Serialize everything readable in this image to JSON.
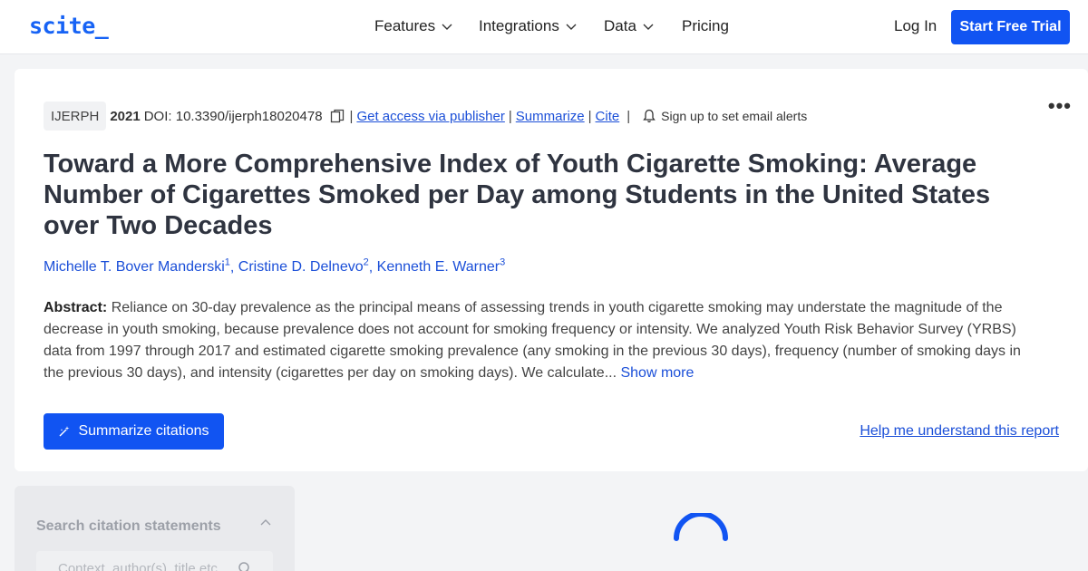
{
  "nav": {
    "logo": "scite_",
    "items": [
      {
        "label": "Features",
        "has_dropdown": true
      },
      {
        "label": "Integrations",
        "has_dropdown": true
      },
      {
        "label": "Data",
        "has_dropdown": true
      },
      {
        "label": "Pricing",
        "has_dropdown": false
      }
    ],
    "login": "Log In",
    "cta": "Start Free Trial"
  },
  "paper": {
    "journal": "IJERPH",
    "year": "2021",
    "doi": "DOI: 10.3390/ijerph18020478",
    "links": {
      "access": "Get access via publisher",
      "summarize": "Summarize",
      "cite": "Cite"
    },
    "alerts": "Sign up to set email alerts",
    "more_icon": "more-horizontal-icon",
    "title": "Toward a More Comprehensive Index of Youth Cigarette Smoking: Average Number of Cigarettes Smoked per Day among Students in the United States over Two Decades",
    "authors": [
      {
        "name": "Michelle T. Bover Manderski",
        "sup": "1"
      },
      {
        "name": "Cristine D. Delnevo",
        "sup": "2"
      },
      {
        "name": "Kenneth E. Warner",
        "sup": "3"
      }
    ],
    "abstract_label": "Abstract:",
    "abstract_text": "Reliance on 30-day prevalence as the principal means of assessing trends in youth cigarette smoking may understate the magnitude of the decrease in youth smoking, because prevalence does not account for smoking frequency or intensity. We analyzed Youth Risk Behavior Survey (YRBS) data from 1997 through 2017 and estimated cigarette smoking prevalence (any smoking in the previous 30 days), frequency (number of smoking days in the previous 30 days), and intensity (cigarettes per day on smoking days). We calculate...",
    "show_more": "Show more",
    "summarize_citations": "Summarize citations",
    "help_link": "Help me understand this report"
  },
  "sidebar": {
    "title": "Search citation statements",
    "search_placeholder": "Context, author(s), title etc."
  },
  "colors": {
    "brand": "#1154f2",
    "link": "#1b4fd8",
    "title": "#2f3440"
  }
}
